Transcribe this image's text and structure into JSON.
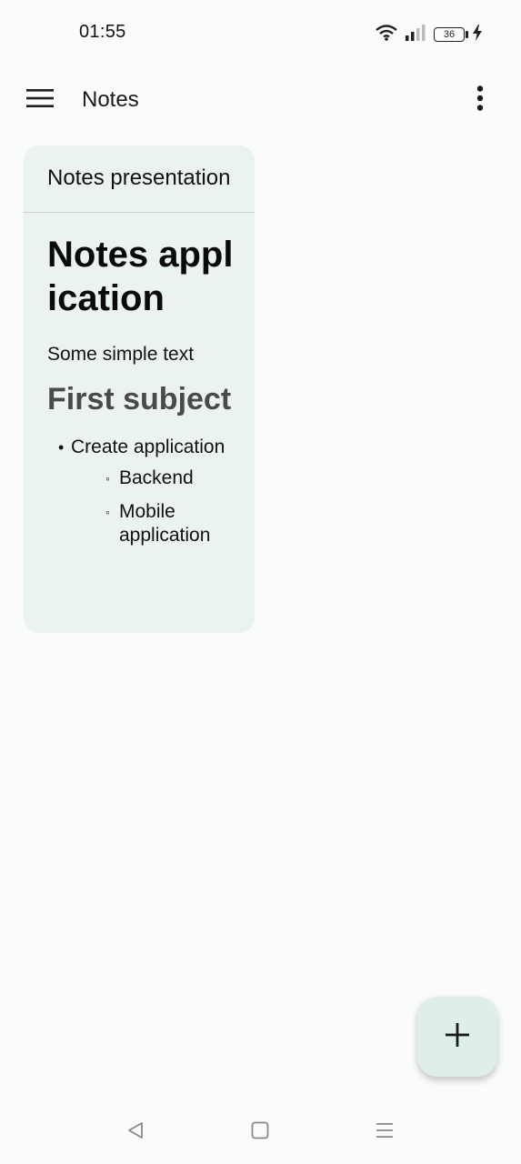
{
  "status_bar": {
    "time": "01:55",
    "battery_level": "36",
    "icons": [
      "wifi-icon",
      "signal-icon",
      "battery-icon",
      "charging-icon"
    ]
  },
  "app_bar": {
    "title": "Notes",
    "menu_icon": "hamburger-menu-icon",
    "more_icon": "more-vertical-icon"
  },
  "notes": [
    {
      "title": "Notes presentation",
      "heading": "Notes application",
      "paragraph": "Some simple text",
      "subheading": "First subject",
      "list": [
        {
          "text": "Create application",
          "children": [
            "Backend",
            "Mobile application"
          ]
        }
      ]
    }
  ],
  "fab": {
    "icon": "plus-icon"
  },
  "nav_bar": {
    "icons": [
      "back-icon",
      "home-icon",
      "recents-icon"
    ]
  },
  "colors": {
    "background": "#fafcfa",
    "card": "#ebf3ef",
    "fab": "#dfeee9",
    "subheading": "#4a4a4a"
  }
}
